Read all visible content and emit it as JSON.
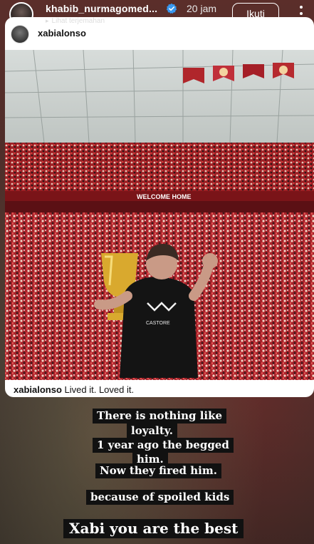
{
  "header": {
    "username": "khabib_nurmagomed...",
    "time": "20 jam",
    "follow_label": "Ikuti",
    "translate_label": "Lihat terjemahan"
  },
  "card": {
    "username": "xabialonso",
    "caption_user": "xabialonso",
    "caption_text": " Lived it. Loved it.",
    "photo_banner": "WELCOME HOME",
    "shirt_text": "CASTORE"
  },
  "overlay_texts": [
    "There is nothing like",
    "loyalty.",
    "1 year ago the begged",
    "him.",
    "Now they fired him.",
    "because of spoiled kids",
    "Xabi you are the best"
  ],
  "colors": {
    "verified": "#3897f0",
    "stadium_red": "#b0262b",
    "text_box": "#111111"
  }
}
